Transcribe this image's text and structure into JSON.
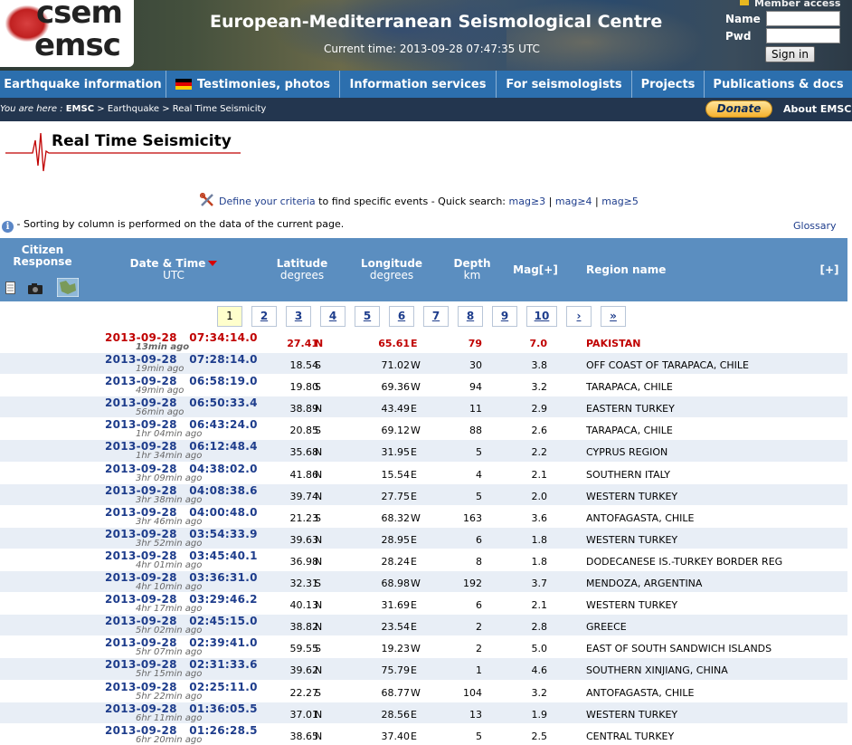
{
  "header": {
    "logo_line1": "csem",
    "logo_line2": "emsc",
    "title": "European-Mediterranean Seismological Centre",
    "current_time": "Current time: 2013-09-28 07:47:35 UTC",
    "member_access": "Member access",
    "name_label": "Name",
    "pwd_label": "Pwd",
    "signin_label": "Sign in"
  },
  "nav": {
    "items": [
      {
        "label": "Earthquake information"
      },
      {
        "label": "Testimonies, photos"
      },
      {
        "label": "Information services"
      },
      {
        "label": "For seismologists"
      },
      {
        "label": "Projects"
      },
      {
        "label": "Publications & docs"
      }
    ]
  },
  "breadcrumb": {
    "you_are_here": "You are here :",
    "emsc": "EMSC",
    "sep1": ">",
    "earthquake": "Earthquake",
    "sep2": ">",
    "current": "Real Time Seismicity"
  },
  "donate_label": "Donate",
  "about_label": "About EMSC",
  "page_title": "Real Time Seismicity",
  "criteria": {
    "link": "Define your criteria",
    "text": " to find specific events - Quick search: ",
    "mag3": "mag≥3",
    "sep": " | ",
    "mag4": "mag≥4",
    "mag5": "mag≥5"
  },
  "info": {
    "icon": "i",
    "text": " - Sorting by column is performed on the data of the current page."
  },
  "glossary_label": "Glossary",
  "table_header": {
    "citizen": "Citizen",
    "response": "Response",
    "datetime": "Date & Time",
    "utc": "UTC",
    "latitude": "Latitude",
    "lat_unit": "degrees",
    "longitude": "Longitude",
    "lon_unit": "degrees",
    "depth": "Depth",
    "depth_unit": "km",
    "mag": "Mag[+]",
    "region": "Region name",
    "expand": "[+]"
  },
  "pager": [
    "1",
    "2",
    "3",
    "4",
    "5",
    "6",
    "7",
    "8",
    "9",
    "10",
    "›",
    "»"
  ],
  "events": [
    {
      "date": "2013-09-28",
      "time": "07:34:14.0",
      "ago": "13min ago",
      "lat": "27.41",
      "ns": "N",
      "lon": "65.61",
      "ew": "E",
      "depth": "79",
      "mag": "7.0",
      "region": "PAKISTAN"
    },
    {
      "date": "2013-09-28",
      "time": "07:28:14.0",
      "ago": "19min ago",
      "lat": "18.54",
      "ns": "S",
      "lon": "71.02",
      "ew": "W",
      "depth": "30",
      "mag": "3.8",
      "region": "OFF COAST OF TARAPACA, CHILE"
    },
    {
      "date": "2013-09-28",
      "time": "06:58:19.0",
      "ago": "49min ago",
      "lat": "19.80",
      "ns": "S",
      "lon": "69.36",
      "ew": "W",
      "depth": "94",
      "mag": "3.2",
      "region": "TARAPACA, CHILE"
    },
    {
      "date": "2013-09-28",
      "time": "06:50:33.4",
      "ago": "56min ago",
      "lat": "38.89",
      "ns": "N",
      "lon": "43.49",
      "ew": "E",
      "depth": "11",
      "mag": "2.9",
      "region": "EASTERN TURKEY"
    },
    {
      "date": "2013-09-28",
      "time": "06:43:24.0",
      "ago": "1hr 04min ago",
      "lat": "20.85",
      "ns": "S",
      "lon": "69.12",
      "ew": "W",
      "depth": "88",
      "mag": "2.6",
      "region": "TARAPACA, CHILE"
    },
    {
      "date": "2013-09-28",
      "time": "06:12:48.4",
      "ago": "1hr 34min ago",
      "lat": "35.68",
      "ns": "N",
      "lon": "31.95",
      "ew": "E",
      "depth": "5",
      "mag": "2.2",
      "region": "CYPRUS REGION"
    },
    {
      "date": "2013-09-28",
      "time": "04:38:02.0",
      "ago": "3hr 09min ago",
      "lat": "41.86",
      "ns": "N",
      "lon": "15.54",
      "ew": "E",
      "depth": "4",
      "mag": "2.1",
      "region": "SOUTHERN ITALY"
    },
    {
      "date": "2013-09-28",
      "time": "04:08:38.6",
      "ago": "3hr 38min ago",
      "lat": "39.74",
      "ns": "N",
      "lon": "27.75",
      "ew": "E",
      "depth": "5",
      "mag": "2.0",
      "region": "WESTERN TURKEY"
    },
    {
      "date": "2013-09-28",
      "time": "04:00:48.0",
      "ago": "3hr 46min ago",
      "lat": "21.23",
      "ns": "S",
      "lon": "68.32",
      "ew": "W",
      "depth": "163",
      "mag": "3.6",
      "region": "ANTOFAGASTA, CHILE"
    },
    {
      "date": "2013-09-28",
      "time": "03:54:33.9",
      "ago": "3hr 52min ago",
      "lat": "39.63",
      "ns": "N",
      "lon": "28.95",
      "ew": "E",
      "depth": "6",
      "mag": "1.8",
      "region": "WESTERN TURKEY"
    },
    {
      "date": "2013-09-28",
      "time": "03:45:40.1",
      "ago": "4hr 01min ago",
      "lat": "36.98",
      "ns": "N",
      "lon": "28.24",
      "ew": "E",
      "depth": "8",
      "mag": "1.8",
      "region": "DODECANESE IS.-TURKEY BORDER REG"
    },
    {
      "date": "2013-09-28",
      "time": "03:36:31.0",
      "ago": "4hr 10min ago",
      "lat": "32.31",
      "ns": "S",
      "lon": "68.98",
      "ew": "W",
      "depth": "192",
      "mag": "3.7",
      "region": "MENDOZA, ARGENTINA"
    },
    {
      "date": "2013-09-28",
      "time": "03:29:46.2",
      "ago": "4hr 17min ago",
      "lat": "40.13",
      "ns": "N",
      "lon": "31.69",
      "ew": "E",
      "depth": "6",
      "mag": "2.1",
      "region": "WESTERN TURKEY"
    },
    {
      "date": "2013-09-28",
      "time": "02:45:15.0",
      "ago": "5hr 02min ago",
      "lat": "38.82",
      "ns": "N",
      "lon": "23.54",
      "ew": "E",
      "depth": "2",
      "mag": "2.8",
      "region": "GREECE"
    },
    {
      "date": "2013-09-28",
      "time": "02:39:41.0",
      "ago": "5hr 07min ago",
      "lat": "59.55",
      "ns": "S",
      "lon": "19.23",
      "ew": "W",
      "depth": "2",
      "mag": "5.0",
      "region": "EAST OF SOUTH SANDWICH ISLANDS"
    },
    {
      "date": "2013-09-28",
      "time": "02:31:33.6",
      "ago": "5hr 15min ago",
      "lat": "39.62",
      "ns": "N",
      "lon": "75.79",
      "ew": "E",
      "depth": "1",
      "mag": "4.6",
      "region": "SOUTHERN XINJIANG, CHINA"
    },
    {
      "date": "2013-09-28",
      "time": "02:25:11.0",
      "ago": "5hr 22min ago",
      "lat": "22.27",
      "ns": "S",
      "lon": "68.77",
      "ew": "W",
      "depth": "104",
      "mag": "3.2",
      "region": "ANTOFAGASTA, CHILE"
    },
    {
      "date": "2013-09-28",
      "time": "01:36:05.5",
      "ago": "6hr 11min ago",
      "lat": "37.01",
      "ns": "N",
      "lon": "28.56",
      "ew": "E",
      "depth": "13",
      "mag": "1.9",
      "region": "WESTERN TURKEY"
    },
    {
      "date": "2013-09-28",
      "time": "01:26:28.5",
      "ago": "6hr 20min ago",
      "lat": "38.65",
      "ns": "N",
      "lon": "37.40",
      "ew": "E",
      "depth": "5",
      "mag": "2.5",
      "region": "CENTRAL TURKEY"
    }
  ],
  "highlight_color": "#c00000",
  "link_color": "#1e3d8c",
  "header_color": "#5b8ec0"
}
